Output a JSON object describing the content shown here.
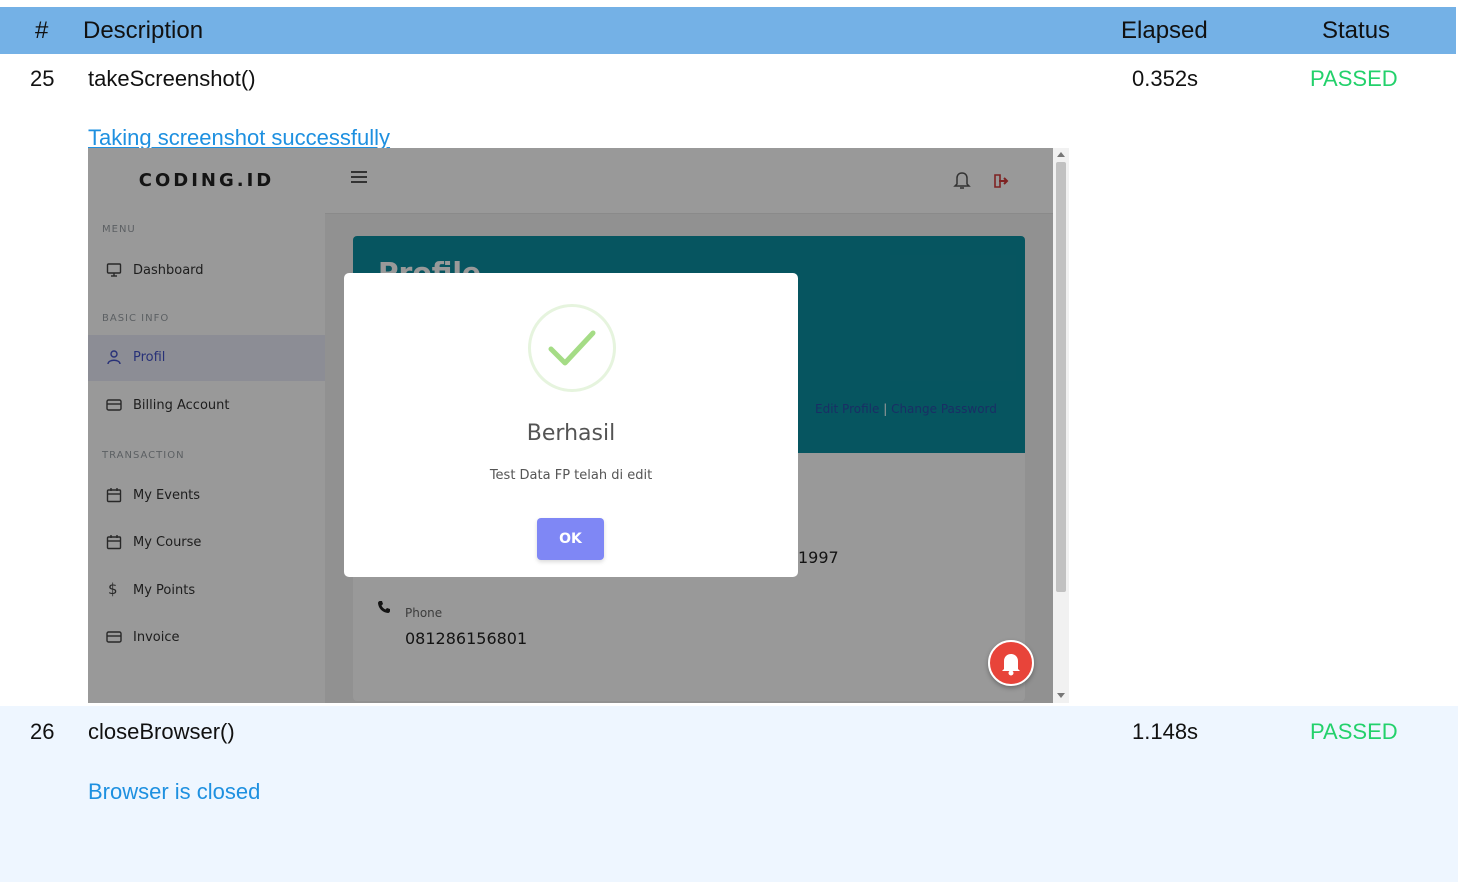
{
  "header": {
    "num_label": "#",
    "description_label": "Description",
    "elapsed_label": "Elapsed",
    "status_label": "Status"
  },
  "steps": [
    {
      "num": "25",
      "description": "takeScreenshot()",
      "elapsed": "0.352s",
      "status": "PASSED",
      "message": "Taking screenshot successfully"
    },
    {
      "num": "26",
      "description": "closeBrowser()",
      "elapsed": "1.148s",
      "status": "PASSED",
      "message": "Browser is closed"
    }
  ],
  "screenshot": {
    "brand": "CODING.ID",
    "sections": {
      "menu": "MENU",
      "basic_info": "BASIC INFO",
      "transaction": "TRANSACTION"
    },
    "sidebar_items": [
      {
        "label": "Dashboard",
        "icon": "monitor-icon"
      },
      {
        "label": "Profil",
        "icon": "user-icon"
      },
      {
        "label": "Billing Account",
        "icon": "card-icon"
      },
      {
        "label": "My Events",
        "icon": "calendar-icon"
      },
      {
        "label": "My Course",
        "icon": "calendar-icon"
      },
      {
        "label": "My Points",
        "icon": "dollar-icon"
      },
      {
        "label": "Invoice",
        "icon": "card-icon"
      }
    ],
    "profile_title": "Profile",
    "edit_profile_link": "Edit Profile",
    "change_password_link": "Change Password",
    "birth_year_partial": "1997",
    "phone_label": "Phone",
    "phone_value": "081286156801",
    "modal": {
      "title": "Berhasil",
      "text": "Test Data FP telah di edit",
      "ok_label": "OK"
    },
    "colors": {
      "card_header": "#0b8ea0",
      "ok_button": "#7f87f5",
      "success_check": "#a5dc86"
    }
  }
}
